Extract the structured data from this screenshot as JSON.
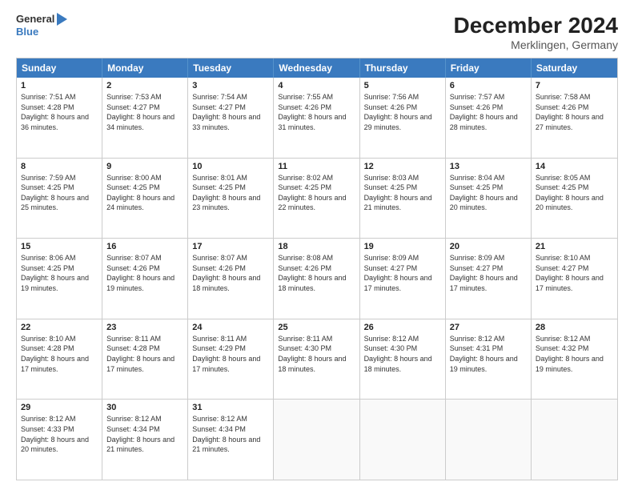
{
  "logo": {
    "line1": "General",
    "line2": "Blue"
  },
  "title": "December 2024",
  "subtitle": "Merklingen, Germany",
  "days": [
    "Sunday",
    "Monday",
    "Tuesday",
    "Wednesday",
    "Thursday",
    "Friday",
    "Saturday"
  ],
  "weeks": [
    [
      {
        "day": "1",
        "sunrise": "7:51 AM",
        "sunset": "4:28 PM",
        "daylight": "8 hours and 36 minutes."
      },
      {
        "day": "2",
        "sunrise": "7:53 AM",
        "sunset": "4:27 PM",
        "daylight": "8 hours and 34 minutes."
      },
      {
        "day": "3",
        "sunrise": "7:54 AM",
        "sunset": "4:27 PM",
        "daylight": "8 hours and 33 minutes."
      },
      {
        "day": "4",
        "sunrise": "7:55 AM",
        "sunset": "4:26 PM",
        "daylight": "8 hours and 31 minutes."
      },
      {
        "day": "5",
        "sunrise": "7:56 AM",
        "sunset": "4:26 PM",
        "daylight": "8 hours and 29 minutes."
      },
      {
        "day": "6",
        "sunrise": "7:57 AM",
        "sunset": "4:26 PM",
        "daylight": "8 hours and 28 minutes."
      },
      {
        "day": "7",
        "sunrise": "7:58 AM",
        "sunset": "4:26 PM",
        "daylight": "8 hours and 27 minutes."
      }
    ],
    [
      {
        "day": "8",
        "sunrise": "7:59 AM",
        "sunset": "4:25 PM",
        "daylight": "8 hours and 25 minutes."
      },
      {
        "day": "9",
        "sunrise": "8:00 AM",
        "sunset": "4:25 PM",
        "daylight": "8 hours and 24 minutes."
      },
      {
        "day": "10",
        "sunrise": "8:01 AM",
        "sunset": "4:25 PM",
        "daylight": "8 hours and 23 minutes."
      },
      {
        "day": "11",
        "sunrise": "8:02 AM",
        "sunset": "4:25 PM",
        "daylight": "8 hours and 22 minutes."
      },
      {
        "day": "12",
        "sunrise": "8:03 AM",
        "sunset": "4:25 PM",
        "daylight": "8 hours and 21 minutes."
      },
      {
        "day": "13",
        "sunrise": "8:04 AM",
        "sunset": "4:25 PM",
        "daylight": "8 hours and 20 minutes."
      },
      {
        "day": "14",
        "sunrise": "8:05 AM",
        "sunset": "4:25 PM",
        "daylight": "8 hours and 20 minutes."
      }
    ],
    [
      {
        "day": "15",
        "sunrise": "8:06 AM",
        "sunset": "4:25 PM",
        "daylight": "8 hours and 19 minutes."
      },
      {
        "day": "16",
        "sunrise": "8:07 AM",
        "sunset": "4:26 PM",
        "daylight": "8 hours and 19 minutes."
      },
      {
        "day": "17",
        "sunrise": "8:07 AM",
        "sunset": "4:26 PM",
        "daylight": "8 hours and 18 minutes."
      },
      {
        "day": "18",
        "sunrise": "8:08 AM",
        "sunset": "4:26 PM",
        "daylight": "8 hours and 18 minutes."
      },
      {
        "day": "19",
        "sunrise": "8:09 AM",
        "sunset": "4:27 PM",
        "daylight": "8 hours and 17 minutes."
      },
      {
        "day": "20",
        "sunrise": "8:09 AM",
        "sunset": "4:27 PM",
        "daylight": "8 hours and 17 minutes."
      },
      {
        "day": "21",
        "sunrise": "8:10 AM",
        "sunset": "4:27 PM",
        "daylight": "8 hours and 17 minutes."
      }
    ],
    [
      {
        "day": "22",
        "sunrise": "8:10 AM",
        "sunset": "4:28 PM",
        "daylight": "8 hours and 17 minutes."
      },
      {
        "day": "23",
        "sunrise": "8:11 AM",
        "sunset": "4:28 PM",
        "daylight": "8 hours and 17 minutes."
      },
      {
        "day": "24",
        "sunrise": "8:11 AM",
        "sunset": "4:29 PM",
        "daylight": "8 hours and 17 minutes."
      },
      {
        "day": "25",
        "sunrise": "8:11 AM",
        "sunset": "4:30 PM",
        "daylight": "8 hours and 18 minutes."
      },
      {
        "day": "26",
        "sunrise": "8:12 AM",
        "sunset": "4:30 PM",
        "daylight": "8 hours and 18 minutes."
      },
      {
        "day": "27",
        "sunrise": "8:12 AM",
        "sunset": "4:31 PM",
        "daylight": "8 hours and 19 minutes."
      },
      {
        "day": "28",
        "sunrise": "8:12 AM",
        "sunset": "4:32 PM",
        "daylight": "8 hours and 19 minutes."
      }
    ],
    [
      {
        "day": "29",
        "sunrise": "8:12 AM",
        "sunset": "4:33 PM",
        "daylight": "8 hours and 20 minutes."
      },
      {
        "day": "30",
        "sunrise": "8:12 AM",
        "sunset": "4:34 PM",
        "daylight": "8 hours and 21 minutes."
      },
      {
        "day": "31",
        "sunrise": "8:12 AM",
        "sunset": "4:34 PM",
        "daylight": "8 hours and 21 minutes."
      },
      null,
      null,
      null,
      null
    ]
  ],
  "labels": {
    "sunrise": "Sunrise: ",
    "sunset": "Sunset: ",
    "daylight": "Daylight: "
  }
}
